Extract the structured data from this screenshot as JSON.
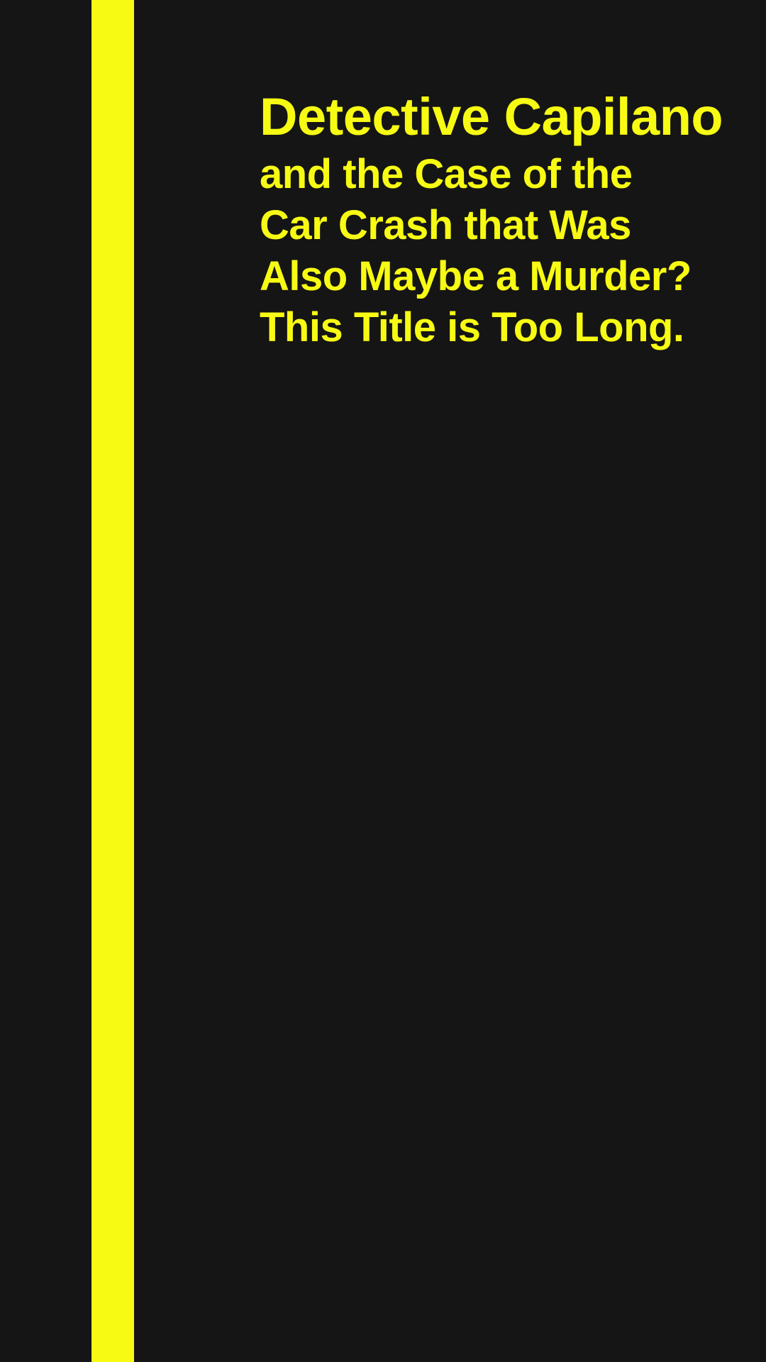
{
  "colors": {
    "background": "#151515",
    "accent": "#f7fb13"
  },
  "title": {
    "main": "Detective Capilano",
    "lines": [
      "and the Case of the",
      "Car Crash that Was",
      "Also Maybe a Murder?",
      "This Title is Too Long."
    ]
  }
}
